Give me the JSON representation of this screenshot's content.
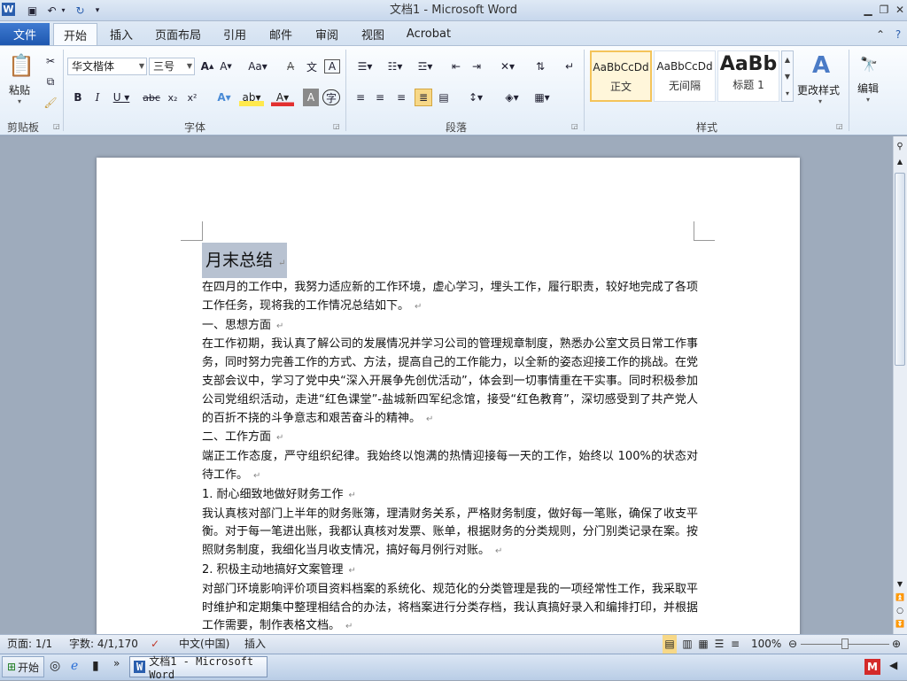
{
  "window": {
    "title": "文档1 - Microsoft Word"
  },
  "tabs": [
    {
      "label": "文件"
    },
    {
      "label": "开始"
    },
    {
      "label": "插入"
    },
    {
      "label": "页面布局"
    },
    {
      "label": "引用"
    },
    {
      "label": "邮件"
    },
    {
      "label": "审阅"
    },
    {
      "label": "视图"
    },
    {
      "label": "Acrobat"
    }
  ],
  "ribbon": {
    "clipboard": {
      "label": "剪贴板",
      "paste": "粘贴"
    },
    "font": {
      "label": "字体",
      "family": "华文楷体",
      "size": "三号"
    },
    "paragraph": {
      "label": "段落"
    },
    "styles": {
      "label": "样式",
      "items": [
        {
          "sample": "AaBbCcDd",
          "name": "正文"
        },
        {
          "sample": "AaBbCcDd",
          "name": "无间隔"
        },
        {
          "sample": "AaBb",
          "name": "标题 1"
        }
      ],
      "change": "更改样式"
    },
    "editing": {
      "label": "编辑"
    }
  },
  "document": {
    "title": "月末总结",
    "paragraphs": [
      "在四月的工作中，我努力适应新的工作环境，虚心学习，埋头工作，履行职责，较好地完成了各项工作任务，现将我的工作情况总结如下。",
      "一、思想方面",
      "在工作初期，我认真了解公司的发展情况并学习公司的管理规章制度，熟悉办公室文员日常工作事务，同时努力完善工作的方式、方法，提高自己的工作能力，以全新的姿态迎接工作的挑战。在党支部会议中，学习了党中央“深入开展争先创优活动”，体会到一切事情重在干实事。同时积极参加公司党组织活动，走进“红色课堂”-盐城新四军纪念馆，接受“红色教育”，深切感受到了共产党人的百折不挠的斗争意志和艰苦奋斗的精神。",
      "二、工作方面",
      "端正工作态度，严守组织纪律。我始终以饱满的热情迎接每一天的工作，始终以 100%的状态对待工作。",
      "1. 耐心细致地做好财务工作",
      "我认真核对部门上半年的财务账簿，理清财务关系，严格财务制度，做好每一笔账，确保了收支平衡。对于每一笔进出账，我都认真核对发票、账单，根据财务的分类规则，分门别类记录在案。按照财务制度，我细化当月收支情况，搞好每月例行对账。",
      "2. 积极主动地搞好文案管理",
      "对部门环境影响评价项目资料档案的系统化、规范化的分类管理是我的一项经常性工作，我采取平时维护和定期集中整理相结合的办法，将档案进行分类存档，我认真搞好录入和编排打印，并根据工作需要，制作表格文档。"
    ]
  },
  "status": {
    "page": "页面: 1/1",
    "words": "字数: 4/1,170",
    "language": "中文(中国)",
    "insert": "插入",
    "zoom": "100%"
  },
  "taskbar": {
    "start": "开始",
    "word": "文档1 - Microsoft Word"
  }
}
